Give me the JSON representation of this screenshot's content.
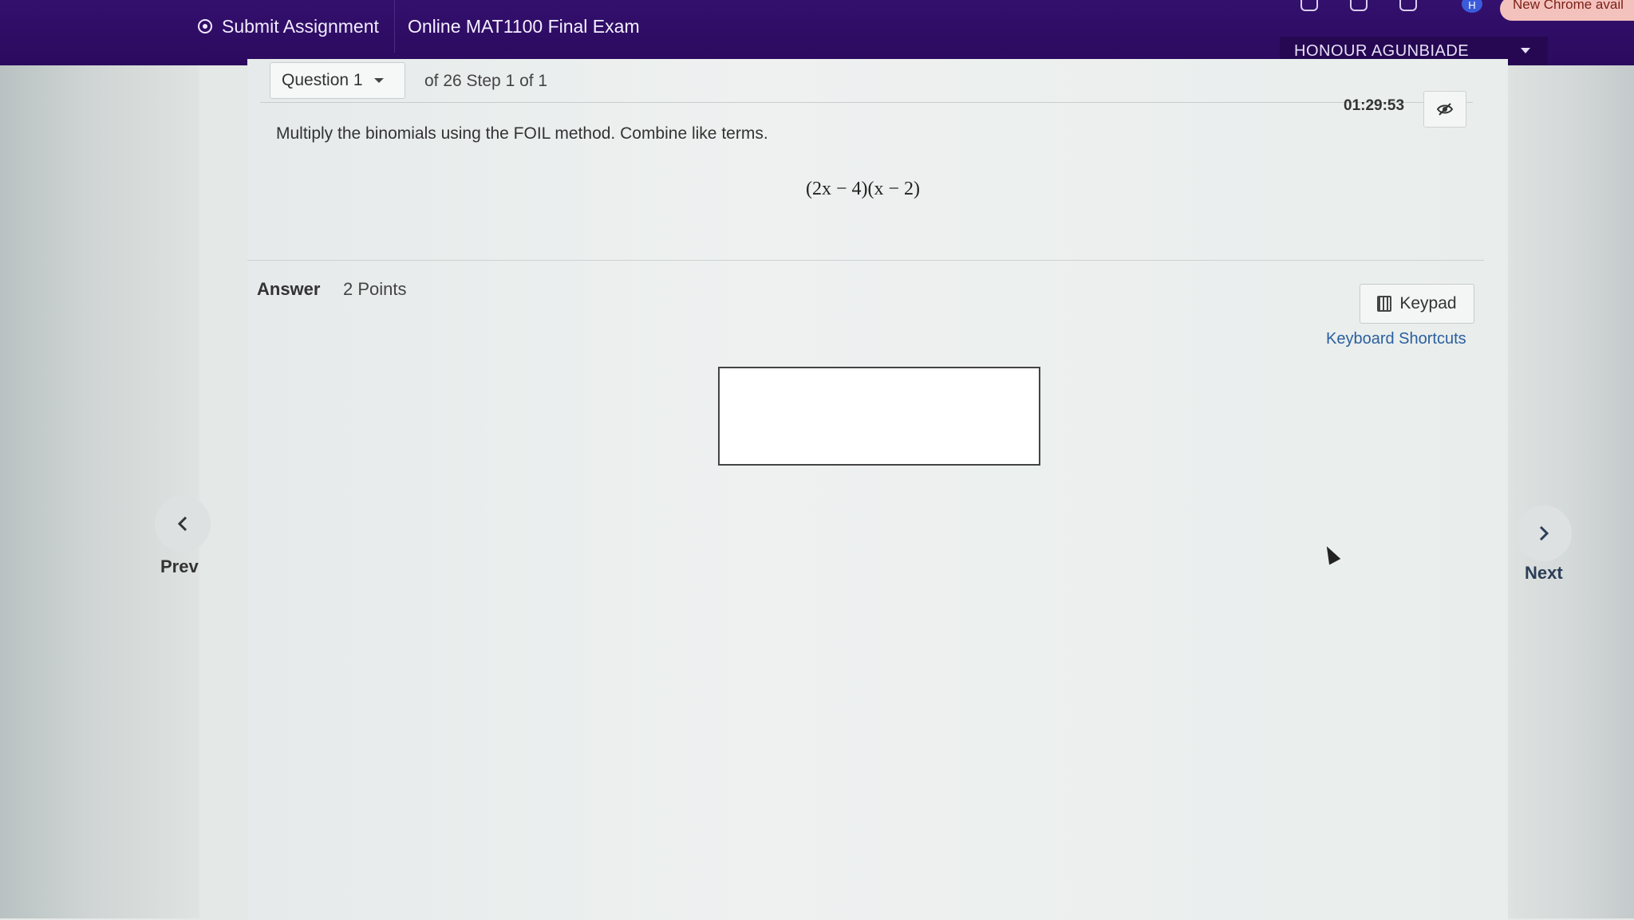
{
  "topbar": {
    "submit_label": "Submit Assignment",
    "exam_title": "Online MAT1100 Final Exam",
    "user_name": "HONOUR AGUNBIADE",
    "chrome_update": "New Chrome avail",
    "avatar_letter": "H"
  },
  "question_bar": {
    "question_select": "Question 1",
    "progress": "of 26 Step 1 of 1",
    "timer": "01:29:53"
  },
  "question": {
    "text": "Multiply the binomials using the FOIL method. Combine like terms.",
    "expression": "(2x − 4)(x − 2)"
  },
  "answer": {
    "label": "Answer",
    "points": "2 Points",
    "keypad_label": "Keypad",
    "shortcuts_label": "Keyboard Shortcuts",
    "input_value": ""
  },
  "navigation": {
    "prev_label": "Prev",
    "next_label": "Next"
  },
  "colors": {
    "header": "#2b0a5e",
    "link": "#2a5f9e"
  }
}
